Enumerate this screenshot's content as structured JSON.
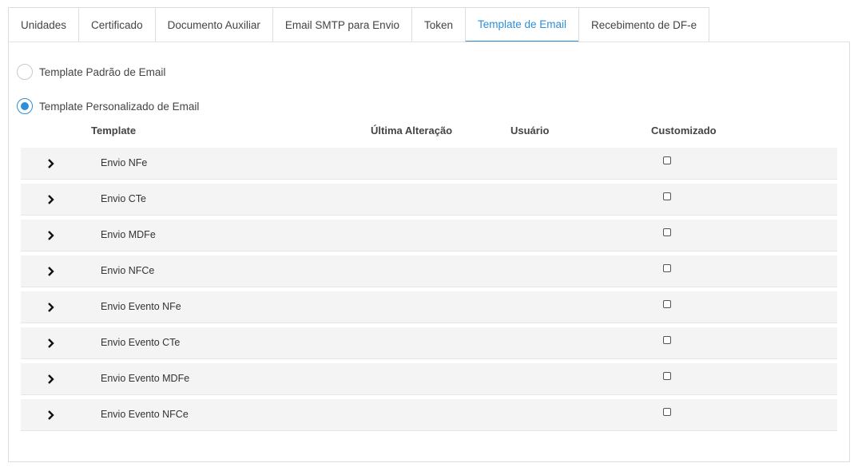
{
  "tabs": [
    {
      "label": "Unidades",
      "active": false
    },
    {
      "label": "Certificado",
      "active": false
    },
    {
      "label": "Documento Auxiliar",
      "active": false
    },
    {
      "label": "Email SMTP para Envio",
      "active": false
    },
    {
      "label": "Token",
      "active": false
    },
    {
      "label": "Template de Email",
      "active": true
    },
    {
      "label": "Recebimento de DF-e",
      "active": false
    }
  ],
  "options": {
    "default_label": "Template Padrão de Email",
    "default_selected": false,
    "custom_label": "Template Personalizado de Email",
    "custom_selected": true
  },
  "table": {
    "headers": {
      "template": "Template",
      "ultima_alteracao": "Última Alteração",
      "usuario": "Usuário",
      "customizado": "Customizado"
    },
    "rows": [
      {
        "template": "Envio NFe",
        "customizado": false
      },
      {
        "template": "Envio CTe",
        "customizado": false
      },
      {
        "template": "Envio MDFe",
        "customizado": false
      },
      {
        "template": "Envio NFCe",
        "customizado": false
      },
      {
        "template": "Envio Evento NFe",
        "customizado": false
      },
      {
        "template": "Envio Evento CTe",
        "customizado": false
      },
      {
        "template": "Envio Evento MDFe",
        "customizado": false
      },
      {
        "template": "Envio Evento NFCe",
        "customizado": false
      }
    ]
  },
  "icons": {
    "expand": "chevron-right-icon"
  },
  "colors": {
    "accent": "#2f8ed8",
    "row_bg": "#f4f4f4",
    "border": "#dddddd"
  }
}
